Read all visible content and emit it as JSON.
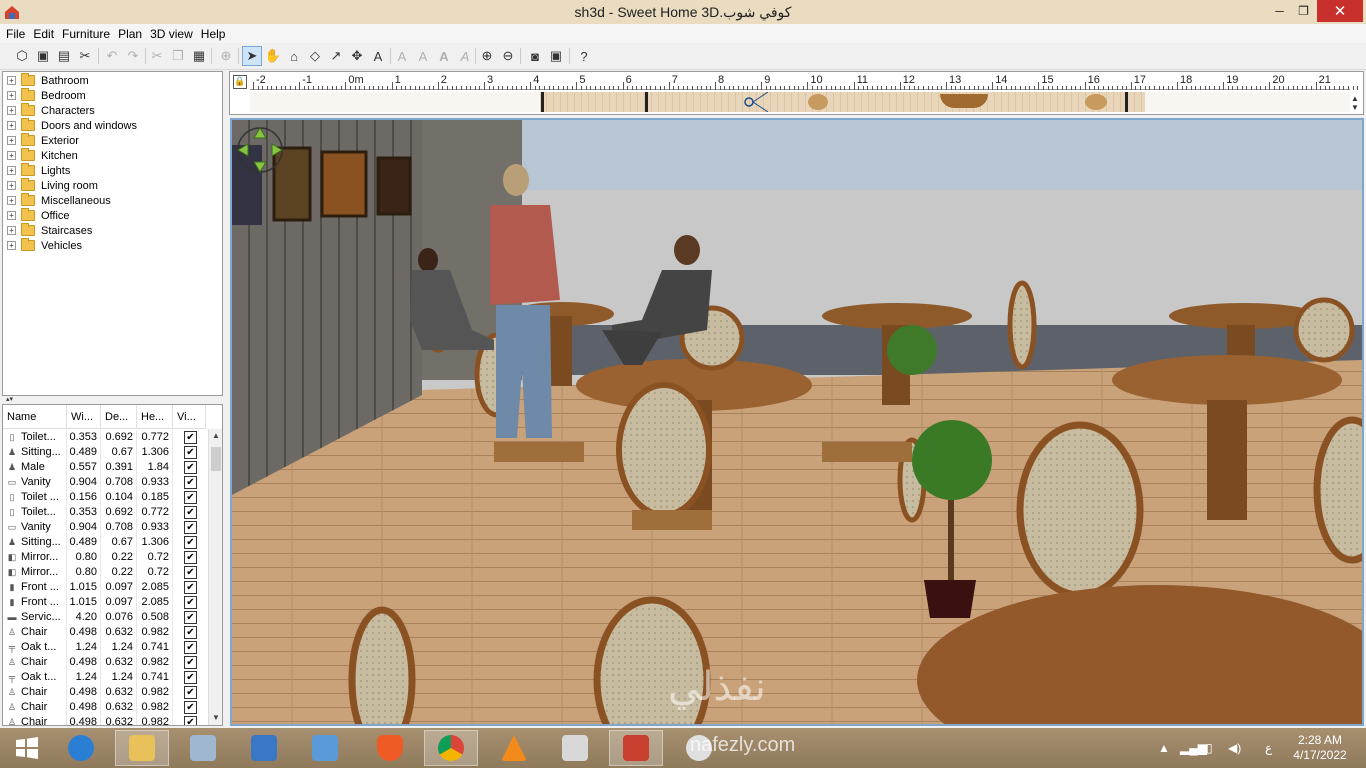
{
  "window": {
    "title": "sh3d - Sweet Home 3D.كوفي شوب",
    "minimize": "─",
    "maximize": "❐",
    "close": "✕"
  },
  "menu": [
    "File",
    "Edit",
    "Furniture",
    "Plan",
    "3D view",
    "Help"
  ],
  "toolbar": {
    "icons": [
      "new-home-icon",
      "open-icon",
      "save-icon",
      "cut-preferences-icon",
      "undo-icon",
      "redo-icon",
      "cut-icon",
      "copy-icon",
      "paste-icon",
      "add-furniture-icon",
      "select-icon",
      "pan-icon",
      "create-walls-icon",
      "create-rooms-icon",
      "create-polylines-icon",
      "create-dimensions-icon",
      "create-labels-icon",
      "increase-text-icon",
      "decrease-text-icon",
      "bold-text-icon",
      "italic-text-icon",
      "zoom-in-icon",
      "zoom-out-icon",
      "create-photo-icon",
      "create-video-icon",
      "help-icon"
    ]
  },
  "catalog": {
    "categories": [
      "Bathroom",
      "Bedroom",
      "Characters",
      "Doors and windows",
      "Exterior",
      "Kitchen",
      "Lights",
      "Living room",
      "Miscellaneous",
      "Office",
      "Staircases",
      "Vehicles"
    ]
  },
  "furniture_table": {
    "columns": [
      "Name",
      "Wi...",
      "De...",
      "He...",
      "Vi..."
    ],
    "rows": [
      {
        "name": "Toilet...",
        "icon": "toilet-icon",
        "w": "0.353",
        "d": "0.692",
        "h": "0.772",
        "visible": true
      },
      {
        "name": "Sitting...",
        "icon": "person-icon",
        "w": "0.489",
        "d": "0.67",
        "h": "1.306",
        "visible": true
      },
      {
        "name": "Male",
        "icon": "person-icon",
        "w": "0.557",
        "d": "0.391",
        "h": "1.84",
        "visible": true
      },
      {
        "name": "Vanity",
        "icon": "vanity-icon",
        "w": "0.904",
        "d": "0.708",
        "h": "0.933",
        "visible": true
      },
      {
        "name": "Toilet ...",
        "icon": "toilet-icon",
        "w": "0.156",
        "d": "0.104",
        "h": "0.185",
        "visible": true
      },
      {
        "name": "Toilet...",
        "icon": "toilet-icon",
        "w": "0.353",
        "d": "0.692",
        "h": "0.772",
        "visible": true
      },
      {
        "name": "Vanity",
        "icon": "vanity-icon",
        "w": "0.904",
        "d": "0.708",
        "h": "0.933",
        "visible": true
      },
      {
        "name": "Sitting...",
        "icon": "person-icon",
        "w": "0.489",
        "d": "0.67",
        "h": "1.306",
        "visible": true
      },
      {
        "name": "Mirror...",
        "icon": "mirror-icon",
        "w": "0.80",
        "d": "0.22",
        "h": "0.72",
        "visible": true
      },
      {
        "name": "Mirror...",
        "icon": "mirror-icon",
        "w": "0.80",
        "d": "0.22",
        "h": "0.72",
        "visible": true
      },
      {
        "name": "Front ...",
        "icon": "door-icon",
        "w": "1.015",
        "d": "0.097",
        "h": "2.085",
        "visible": true
      },
      {
        "name": "Front ...",
        "icon": "door-icon",
        "w": "1.015",
        "d": "0.097",
        "h": "2.085",
        "visible": true
      },
      {
        "name": "Servic...",
        "icon": "counter-icon",
        "w": "4.20",
        "d": "0.076",
        "h": "0.508",
        "visible": true
      },
      {
        "name": "Chair",
        "icon": "chair-icon",
        "w": "0.498",
        "d": "0.632",
        "h": "0.982",
        "visible": true
      },
      {
        "name": "Oak t...",
        "icon": "table-icon",
        "w": "1.24",
        "d": "1.24",
        "h": "0.741",
        "visible": true
      },
      {
        "name": "Chair",
        "icon": "chair-icon",
        "w": "0.498",
        "d": "0.632",
        "h": "0.982",
        "visible": true
      },
      {
        "name": "Oak t...",
        "icon": "table-icon",
        "w": "1.24",
        "d": "1.24",
        "h": "0.741",
        "visible": true
      },
      {
        "name": "Chair",
        "icon": "chair-icon",
        "w": "0.498",
        "d": "0.632",
        "h": "0.982",
        "visible": true
      },
      {
        "name": "Chair",
        "icon": "chair-icon",
        "w": "0.498",
        "d": "0.632",
        "h": "0.982",
        "visible": true
      },
      {
        "name": "Chair",
        "icon": "chair-icon",
        "w": "0.498",
        "d": "0.632",
        "h": "0.982",
        "visible": true
      }
    ]
  },
  "ruler": {
    "labels": [
      "-2",
      "-1",
      "0m",
      "1",
      "2",
      "3",
      "4",
      "5",
      "6",
      "7",
      "8",
      "9",
      "10",
      "11",
      "12",
      "13",
      "14",
      "15",
      "16",
      "17",
      "18",
      "19",
      "20",
      "21"
    ]
  },
  "watermark": {
    "arabic": "نفذلي",
    "latin": "nafezly.com"
  },
  "taskbar": {
    "apps": [
      "start-icon",
      "internet-explorer-icon",
      "file-explorer-icon",
      "performance-monitor-icon",
      "remote-desktop-icon",
      "control-panel-icon",
      "brave-browser-icon",
      "chrome-icon",
      "vlc-icon",
      "calculator-icon",
      "sweet-home-3d-icon",
      "paint-icon"
    ],
    "language": "ع",
    "time": "2:28 AM",
    "date": "4/17/2022"
  },
  "colors": {
    "titlebar": "#e9dcc0",
    "close": "#c7302b",
    "taskbar": "#9a8466",
    "view_border": "#7fa6cc",
    "wood_floor": "#c9a37a"
  }
}
